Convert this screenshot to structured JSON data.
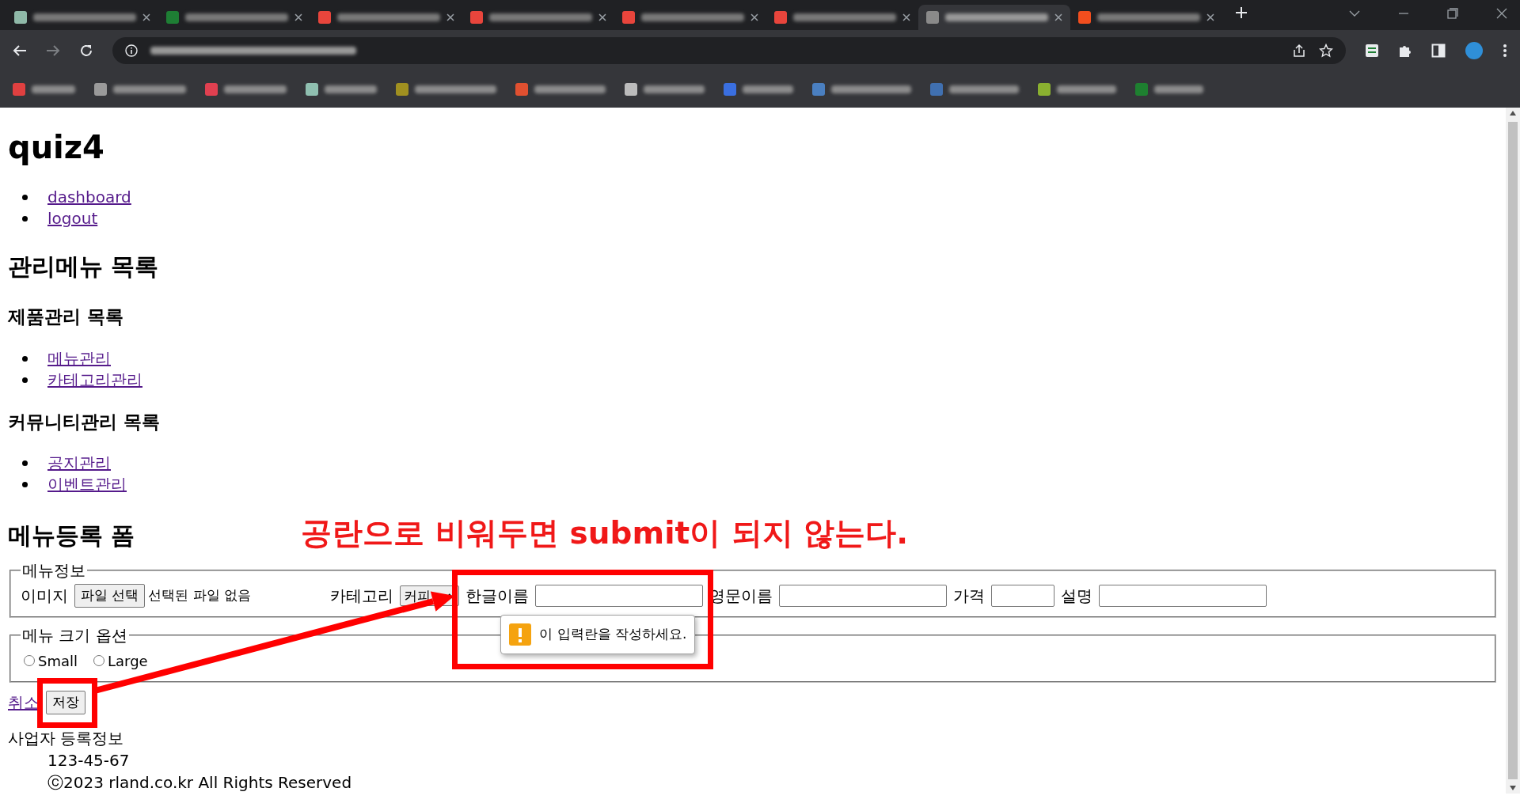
{
  "browser": {
    "tabs": [
      {
        "selected": false,
        "color": "#8fb9a8"
      },
      {
        "selected": false,
        "color": "#1e7e34"
      },
      {
        "selected": false,
        "color": "#e8453c"
      },
      {
        "selected": false,
        "color": "#e8453c"
      },
      {
        "selected": false,
        "color": "#e8453c"
      },
      {
        "selected": false,
        "color": "#e8453c"
      },
      {
        "selected": true,
        "color": "#8a8a8a"
      },
      {
        "selected": false,
        "color": "#f24e1e"
      }
    ],
    "bookmarks": [
      {
        "color": "#e04040"
      },
      {
        "color": "#9a9a9a"
      },
      {
        "color": "#e04050"
      },
      {
        "color": "#8fbfb0"
      },
      {
        "color": "#a09020"
      },
      {
        "color": "#e05030"
      },
      {
        "color": "#bbbbbb"
      },
      {
        "color": "#3a6fe0"
      },
      {
        "color": "#4a7fc0"
      },
      {
        "color": "#4070b0"
      },
      {
        "color": "#8ab030"
      },
      {
        "color": "#1e8030"
      }
    ]
  },
  "page": {
    "title": "quiz4",
    "nav_links": [
      "dashboard",
      "logout"
    ],
    "heading": "관리메뉴 목록",
    "sections": [
      {
        "title": "제품관리 목록",
        "links": [
          "메뉴관리",
          "카테고리관리"
        ]
      },
      {
        "title": "커뮤니티관리 목록",
        "links": [
          "공지관리",
          "이벤트관리"
        ]
      }
    ],
    "form": {
      "title": "메뉴등록 폼",
      "fieldsets": [
        {
          "legend": "메뉴정보",
          "fields": [
            {
              "kind": "file",
              "label": "이미지",
              "button": "파일 선택",
              "status": "선택된 파일 없음"
            },
            {
              "kind": "select",
              "label": "카테고리",
              "value": "커피"
            },
            {
              "kind": "text",
              "label": "한글이름",
              "validation_message": "이 입력란을 작성하세요."
            },
            {
              "kind": "text",
              "label": "영문이름"
            },
            {
              "kind": "short",
              "label": "가격"
            },
            {
              "kind": "text",
              "label": "설명"
            }
          ]
        },
        {
          "legend": "메뉴 크기 옵션",
          "fields": [
            {
              "kind": "radio",
              "label": "Small",
              "checked": false
            },
            {
              "kind": "radio",
              "label": "Large",
              "checked": false
            }
          ]
        }
      ],
      "cancel_link": "취소",
      "submit_button": "저장"
    },
    "footer": {
      "term": "사업자 등록정보",
      "lines": [
        "123-45-67",
        "ⓒ2023 rland.co.kr All Rights Reserved"
      ]
    }
  },
  "annotation": {
    "text": "공란으로 비워두면 submit이 되지 않는다."
  }
}
